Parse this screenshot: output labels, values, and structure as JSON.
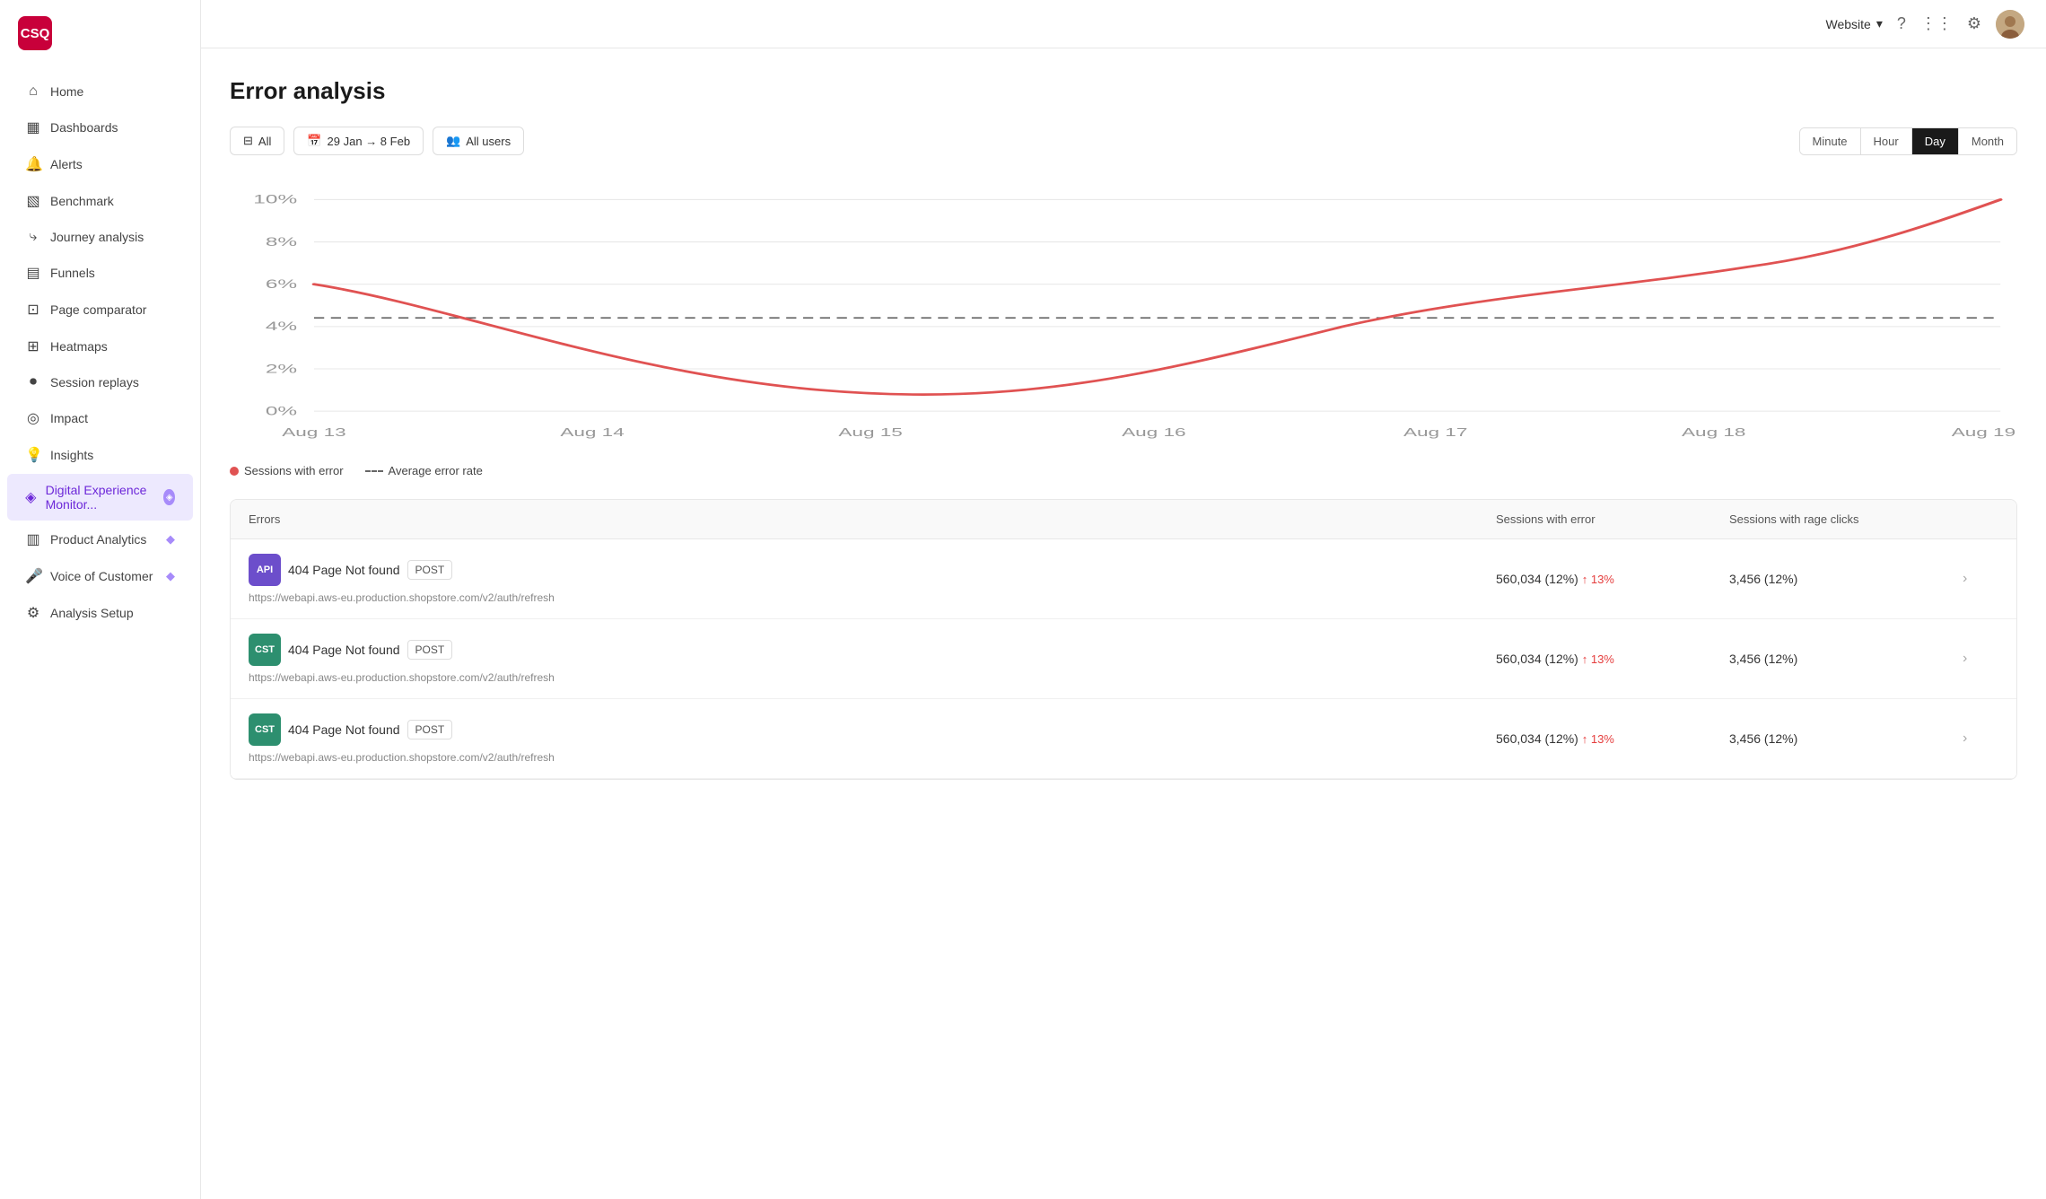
{
  "app": {
    "logo": "CSQ",
    "website_label": "Website",
    "chevron_down": "▾"
  },
  "sidebar": {
    "items": [
      {
        "id": "home",
        "label": "Home",
        "icon": "⌂",
        "active": false
      },
      {
        "id": "dashboards",
        "label": "Dashboards",
        "icon": "▦",
        "active": false
      },
      {
        "id": "alerts",
        "label": "Alerts",
        "icon": "🔔",
        "active": false
      },
      {
        "id": "benchmark",
        "label": "Benchmark",
        "icon": "▧",
        "active": false
      },
      {
        "id": "journey",
        "label": "Journey analysis",
        "icon": "⤷",
        "active": false
      },
      {
        "id": "funnels",
        "label": "Funnels",
        "icon": "▤",
        "active": false
      },
      {
        "id": "page-comparator",
        "label": "Page comparator",
        "icon": "⊡",
        "active": false
      },
      {
        "id": "heatmaps",
        "label": "Heatmaps",
        "icon": "⊞",
        "active": false
      },
      {
        "id": "session-replays",
        "label": "Session replays",
        "icon": "⏺",
        "active": false
      },
      {
        "id": "impact",
        "label": "Impact",
        "icon": "◎",
        "active": false
      },
      {
        "id": "insights",
        "label": "Insights",
        "icon": "💡",
        "active": false
      },
      {
        "id": "digital-experience",
        "label": "Digital Experience Monitor...",
        "icon": "◈",
        "active": true,
        "badge": true
      },
      {
        "id": "product-analytics",
        "label": "Product Analytics",
        "icon": "▥",
        "active": false,
        "gem": true
      },
      {
        "id": "voice-of-customer",
        "label": "Voice of Customer",
        "icon": "🎤",
        "active": false,
        "gem": true
      },
      {
        "id": "analysis-setup",
        "label": "Analysis Setup",
        "icon": "⚙",
        "active": false
      }
    ]
  },
  "page": {
    "title": "Error analysis"
  },
  "filters": {
    "all_label": "All",
    "date_label": "29 Jan → 8 Feb",
    "users_label": "All users"
  },
  "time_granularity": {
    "options": [
      {
        "id": "minute",
        "label": "Minute",
        "active": false
      },
      {
        "id": "hour",
        "label": "Hour",
        "active": false
      },
      {
        "id": "day",
        "label": "Day",
        "active": true
      },
      {
        "id": "month",
        "label": "Month",
        "active": false
      }
    ]
  },
  "chart": {
    "legend": [
      {
        "id": "sessions-error",
        "label": "Sessions with error",
        "type": "dot",
        "color": "#e05252"
      },
      {
        "id": "avg-error-rate",
        "label": "Average error rate",
        "type": "dashed",
        "color": "#555"
      }
    ],
    "x_labels": [
      "Aug 13",
      "Aug 14",
      "Aug 15",
      "Aug 16",
      "Aug 17",
      "Aug 18",
      "Aug 19"
    ],
    "y_labels": [
      "0%",
      "2%",
      "4%",
      "6%",
      "8%",
      "10%"
    ]
  },
  "table": {
    "columns": [
      "Errors",
      "Sessions with error",
      "Sessions with rage clicks"
    ],
    "rows": [
      {
        "badge_label": "API",
        "badge_color": "#6c4ecb",
        "error_label": "404 Page Not found",
        "method": "POST",
        "url": "https://webapi.aws-eu.production.shopstore.com/v2/auth/refresh",
        "sessions": "560,034 (12%)",
        "trend": "↑ 13%",
        "rage_clicks": "3,456 (12%)"
      },
      {
        "badge_label": "CST",
        "badge_color": "#2d8f6f",
        "error_label": "404 Page Not found",
        "method": "POST",
        "url": "https://webapi.aws-eu.production.shopstore.com/v2/auth/refresh",
        "sessions": "560,034 (12%)",
        "trend": "↑ 13%",
        "rage_clicks": "3,456 (12%)"
      },
      {
        "badge_label": "CST",
        "badge_color": "#2d8f6f",
        "error_label": "404 Page Not found",
        "method": "POST",
        "url": "https://webapi.aws-eu.production.shopstore.com/v2/auth/refresh",
        "sessions": "560,034 (12%)",
        "trend": "↑ 13%",
        "rage_clicks": "3,456 (12%)"
      }
    ]
  },
  "icons": {
    "grid": "⋮⋮",
    "settings": "⚙",
    "help": "?",
    "chevron_right": "›"
  }
}
